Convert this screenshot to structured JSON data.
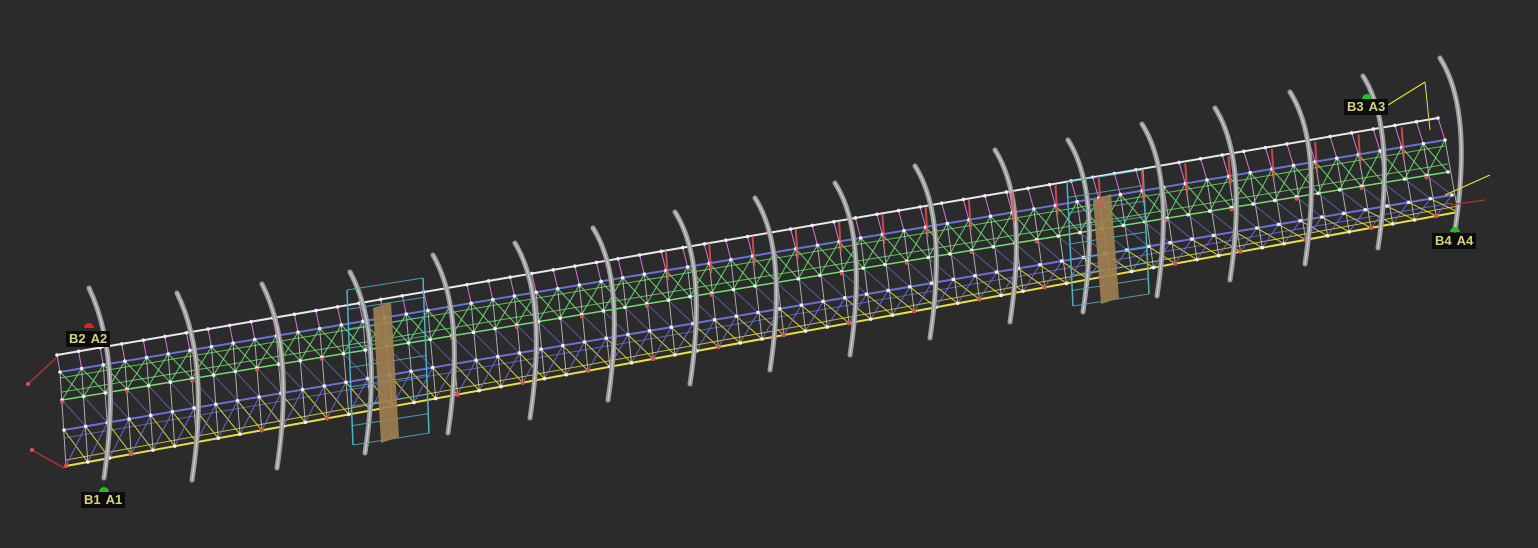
{
  "viewport": {
    "background": "#2b2b2b"
  },
  "supports": [
    {
      "b": "B2",
      "a": "A2",
      "pin_color": "#e02020"
    },
    {
      "b": "B1",
      "a": "A1",
      "pin_color": "#20c020"
    },
    {
      "b": "B3",
      "a": "A3",
      "pin_color": "#20c020"
    },
    {
      "b": "B4",
      "a": "A4",
      "pin_color": "#20c020"
    }
  ],
  "colors": {
    "arch": "#9a9a9a",
    "hanger_top": "#e070e0",
    "chord_top": "#e8e8f0",
    "deck_green": "#70e070",
    "deck_blue": "#6a70d8",
    "chord_bottom": "#e8e040",
    "member_red": "#e05050",
    "brace_cyan": "#50b0c8",
    "plate_tan": "#a08050",
    "end_red": "#b03030"
  }
}
